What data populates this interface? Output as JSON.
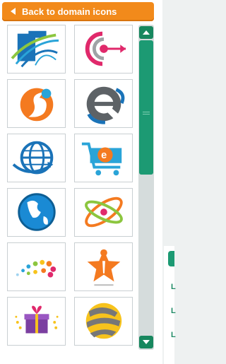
{
  "back_button": {
    "label": "Back to domain icons"
  },
  "icons": [
    {
      "name": "swoosh-arc-logo-icon"
    },
    {
      "name": "target-arrow-logo-icon"
    },
    {
      "name": "orange-s-logo-icon"
    },
    {
      "name": "letter-e-gray-logo-icon"
    },
    {
      "name": "globe-arrow-logo-icon"
    },
    {
      "name": "shopping-cart-e-logo-icon"
    },
    {
      "name": "earth-globe-logo-icon"
    },
    {
      "name": "orbit-rings-logo-icon"
    },
    {
      "name": "colored-dots-arc-logo-icon"
    },
    {
      "name": "star-person-logo-icon"
    },
    {
      "name": "gift-box-logo-icon"
    },
    {
      "name": "striped-sphere-logo-icon"
    }
  ],
  "side_labels": [
    "L",
    "L",
    "L"
  ],
  "colors": {
    "accent": "#f28a1b",
    "scrollbar": "#1c9a73"
  }
}
